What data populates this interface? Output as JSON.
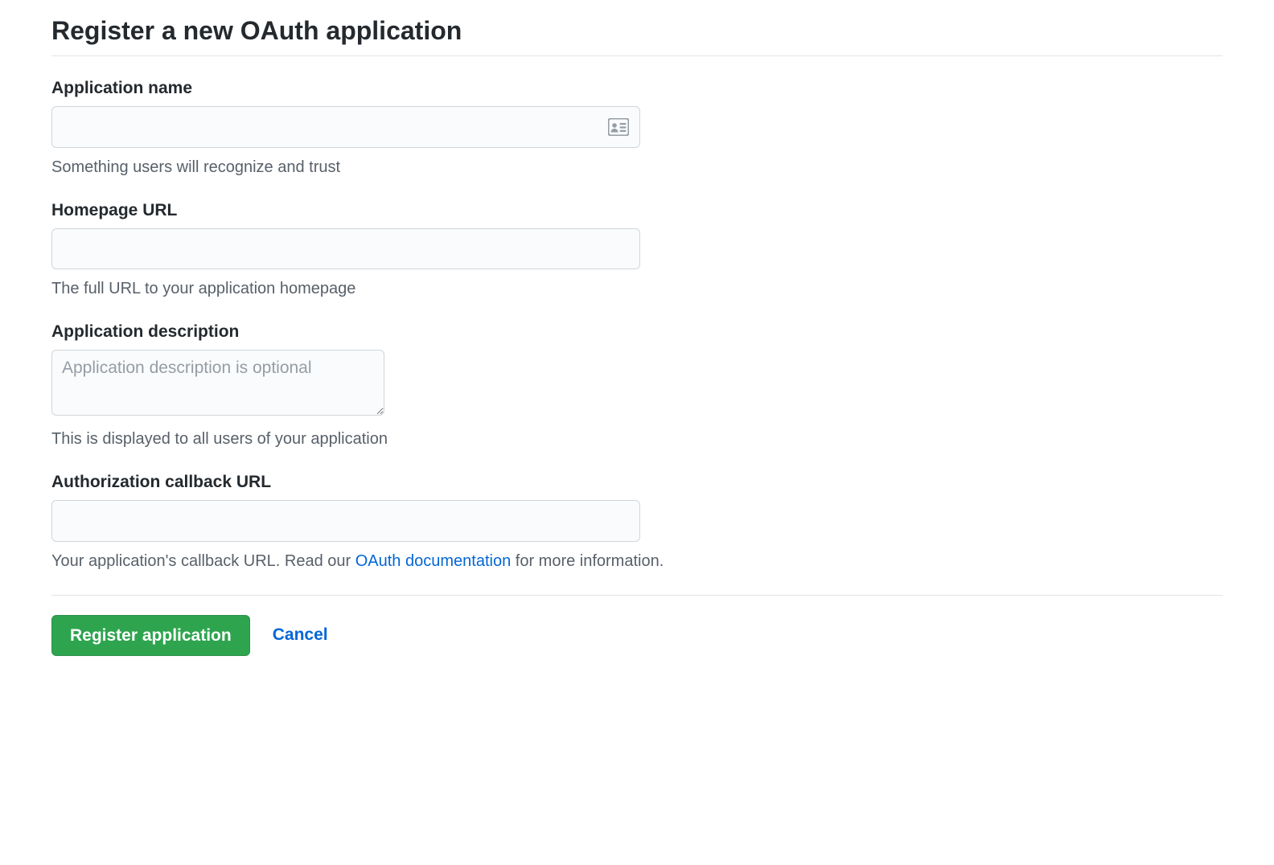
{
  "page_title": "Register a new OAuth application",
  "fields": {
    "app_name": {
      "label": "Application name",
      "value": "",
      "help": "Something users will recognize and trust"
    },
    "homepage_url": {
      "label": "Homepage URL",
      "value": "",
      "help": "The full URL to your application homepage"
    },
    "app_description": {
      "label": "Application description",
      "value": "",
      "placeholder": "Application description is optional",
      "help": "This is displayed to all users of your application"
    },
    "callback_url": {
      "label": "Authorization callback URL",
      "value": "",
      "help_prefix": "Your application's callback URL. Read our ",
      "doc_link_text": "OAuth documentation",
      "help_suffix": " for more information."
    }
  },
  "actions": {
    "submit_label": "Register application",
    "cancel_label": "Cancel"
  }
}
